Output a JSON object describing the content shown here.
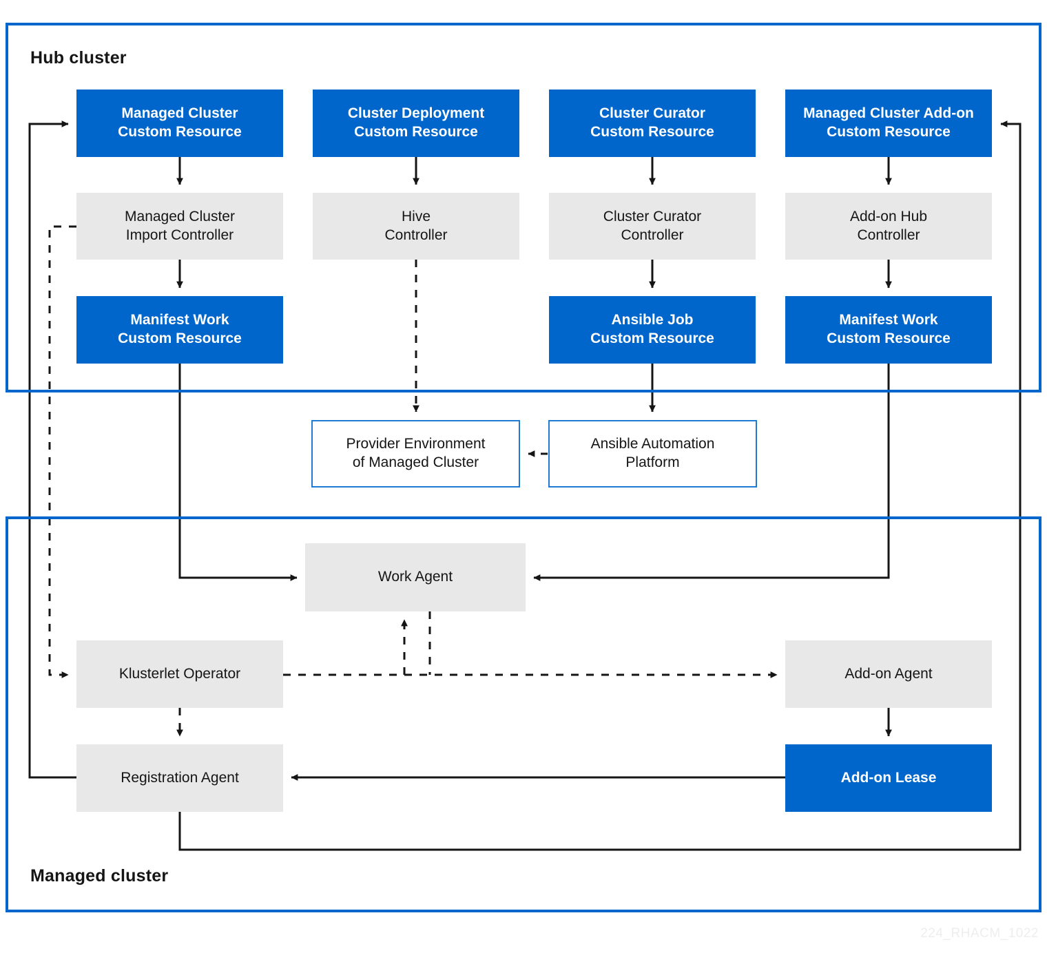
{
  "diagram": {
    "title_watermark": "224_RHACM_1022",
    "colors": {
      "accent_blue": "#0066cc",
      "node_gray": "#e8e8e8",
      "outline_blue": "#1f7ad6",
      "text_dark": "#151515",
      "text_light": "#ffffff"
    },
    "zones": [
      {
        "id": "hub",
        "label": "Hub cluster"
      },
      {
        "id": "managed",
        "label": "Managed cluster"
      }
    ],
    "nodes": [
      {
        "id": "managed-cluster-cr",
        "label": "Managed Cluster\nCustom Resource",
        "style": "blue",
        "zone": "hub"
      },
      {
        "id": "cluster-deployment-cr",
        "label": "Cluster Deployment\nCustom Resource",
        "style": "blue",
        "zone": "hub"
      },
      {
        "id": "cluster-curator-cr",
        "label": "Cluster Curator\nCustom Resource",
        "style": "blue",
        "zone": "hub"
      },
      {
        "id": "managed-cluster-addon-cr",
        "label": "Managed Cluster Add-on\nCustom Resource",
        "style": "blue",
        "zone": "hub"
      },
      {
        "id": "managed-cluster-import-controller",
        "label": "Managed Cluster\nImport Controller",
        "style": "gray",
        "zone": "hub"
      },
      {
        "id": "hive-controller",
        "label": "Hive\nController",
        "style": "gray",
        "zone": "hub"
      },
      {
        "id": "cluster-curator-controller",
        "label": "Cluster Curator\nController",
        "style": "gray",
        "zone": "hub"
      },
      {
        "id": "addon-hub-controller",
        "label": "Add-on Hub\nController",
        "style": "gray",
        "zone": "hub"
      },
      {
        "id": "manifest-work-cr-left",
        "label": "Manifest Work\nCustom Resource",
        "style": "blue",
        "zone": "hub"
      },
      {
        "id": "ansible-job-cr",
        "label": "Ansible Job\nCustom Resource",
        "style": "blue",
        "zone": "hub"
      },
      {
        "id": "manifest-work-cr-right",
        "label": "Manifest Work\nCustom Resource",
        "style": "blue",
        "zone": "hub"
      },
      {
        "id": "provider-environment",
        "label": "Provider Environment\nof Managed Cluster",
        "style": "outline",
        "zone": "middle"
      },
      {
        "id": "ansible-automation-platform",
        "label": "Ansible Automation\nPlatform",
        "style": "outline",
        "zone": "middle"
      },
      {
        "id": "work-agent",
        "label": "Work Agent",
        "style": "gray",
        "zone": "managed"
      },
      {
        "id": "klusterlet-operator",
        "label": "Klusterlet Operator",
        "style": "gray",
        "zone": "managed"
      },
      {
        "id": "registration-agent",
        "label": "Registration Agent",
        "style": "gray",
        "zone": "managed"
      },
      {
        "id": "addon-agent",
        "label": "Add-on Agent",
        "style": "gray",
        "zone": "managed"
      },
      {
        "id": "addon-lease",
        "label": "Add-on Lease",
        "style": "blue",
        "zone": "managed"
      }
    ],
    "edges": [
      {
        "from": "managed-cluster-cr",
        "to": "managed-cluster-import-controller",
        "line": "solid"
      },
      {
        "from": "cluster-deployment-cr",
        "to": "hive-controller",
        "line": "solid"
      },
      {
        "from": "cluster-curator-cr",
        "to": "cluster-curator-controller",
        "line": "solid"
      },
      {
        "from": "managed-cluster-addon-cr",
        "to": "addon-hub-controller",
        "line": "solid"
      },
      {
        "from": "managed-cluster-import-controller",
        "to": "manifest-work-cr-left",
        "line": "solid"
      },
      {
        "from": "cluster-curator-controller",
        "to": "ansible-job-cr",
        "line": "solid"
      },
      {
        "from": "addon-hub-controller",
        "to": "manifest-work-cr-right",
        "line": "solid"
      },
      {
        "from": "hive-controller",
        "to": "provider-environment",
        "line": "dashed"
      },
      {
        "from": "ansible-job-cr",
        "to": "ansible-automation-platform",
        "line": "solid"
      },
      {
        "from": "ansible-automation-platform",
        "to": "provider-environment",
        "line": "dashed"
      },
      {
        "from": "manifest-work-cr-left",
        "to": "work-agent",
        "line": "solid"
      },
      {
        "from": "manifest-work-cr-right",
        "to": "work-agent",
        "line": "solid"
      },
      {
        "from": "managed-cluster-import-controller",
        "to": "klusterlet-operator",
        "line": "dashed"
      },
      {
        "from": "klusterlet-operator",
        "to": "work-agent",
        "line": "dashed"
      },
      {
        "from": "klusterlet-operator",
        "to": "addon-agent",
        "line": "dashed"
      },
      {
        "from": "klusterlet-operator",
        "to": "registration-agent",
        "line": "dashed"
      },
      {
        "from": "addon-agent",
        "to": "addon-lease",
        "line": "solid"
      },
      {
        "from": "addon-lease",
        "to": "registration-agent",
        "line": "solid"
      },
      {
        "from": "registration-agent",
        "to": "managed-cluster-cr",
        "line": "solid"
      },
      {
        "from": "registration-agent",
        "to": "managed-cluster-addon-cr",
        "line": "solid"
      }
    ]
  }
}
